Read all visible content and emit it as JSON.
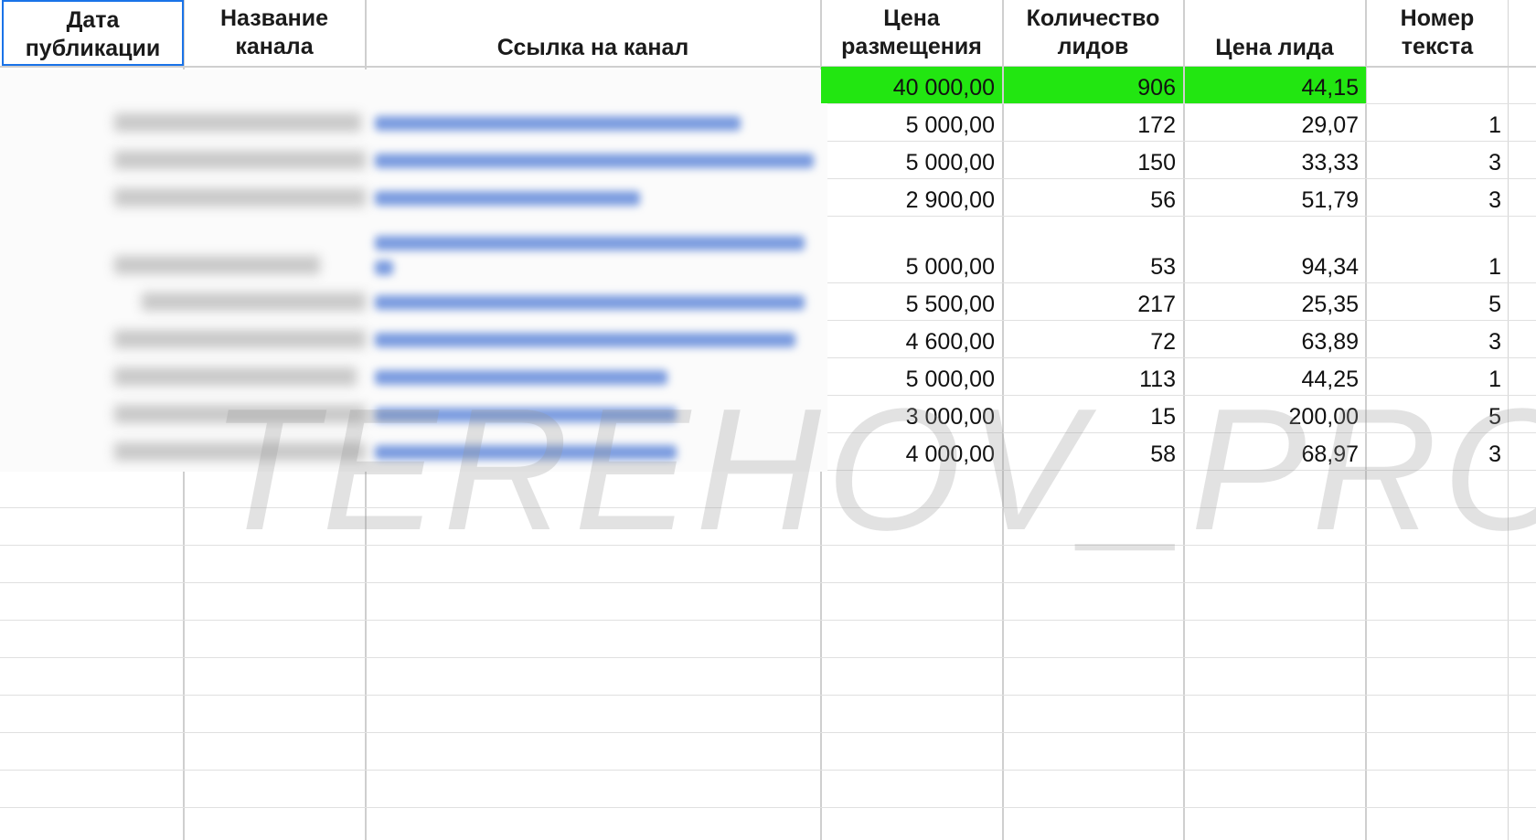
{
  "headers": {
    "date": "Дата публикации",
    "channel_name": "Название канала",
    "channel_link": "Ссылка на канал",
    "placement_price": "Цена размещения",
    "leads_count": "Количество лидов",
    "lead_price": "Цена лида",
    "text_number": "Номер текста"
  },
  "totals": {
    "placement_price": "40 000,00",
    "leads_count": "906",
    "lead_price": "44,15",
    "highlight_color": "#22e611"
  },
  "rows": [
    {
      "price": "5 000,00",
      "leads": "172",
      "lead_price": "29,07",
      "text_no": "1"
    },
    {
      "price": "5 000,00",
      "leads": "150",
      "lead_price": "33,33",
      "text_no": "3"
    },
    {
      "price": "2 900,00",
      "leads": "56",
      "lead_price": "51,79",
      "text_no": "3"
    },
    {
      "price": "5 000,00",
      "leads": "53",
      "lead_price": "94,34",
      "text_no": "1"
    },
    {
      "price": "5 500,00",
      "leads": "217",
      "lead_price": "25,35",
      "text_no": "5"
    },
    {
      "price": "4 600,00",
      "leads": "72",
      "lead_price": "63,89",
      "text_no": "3"
    },
    {
      "price": "5 000,00",
      "leads": "113",
      "lead_price": "44,25",
      "text_no": "1"
    },
    {
      "price": "3 000,00",
      "leads": "15",
      "lead_price": "200,00",
      "text_no": "5"
    },
    {
      "price": "4 000,00",
      "leads": "58",
      "lead_price": "68,97",
      "text_no": "3"
    }
  ],
  "watermark": "TEREHOV_PRO",
  "colors": {
    "selection": "#1a73e8",
    "link": "#4f7bd6"
  }
}
